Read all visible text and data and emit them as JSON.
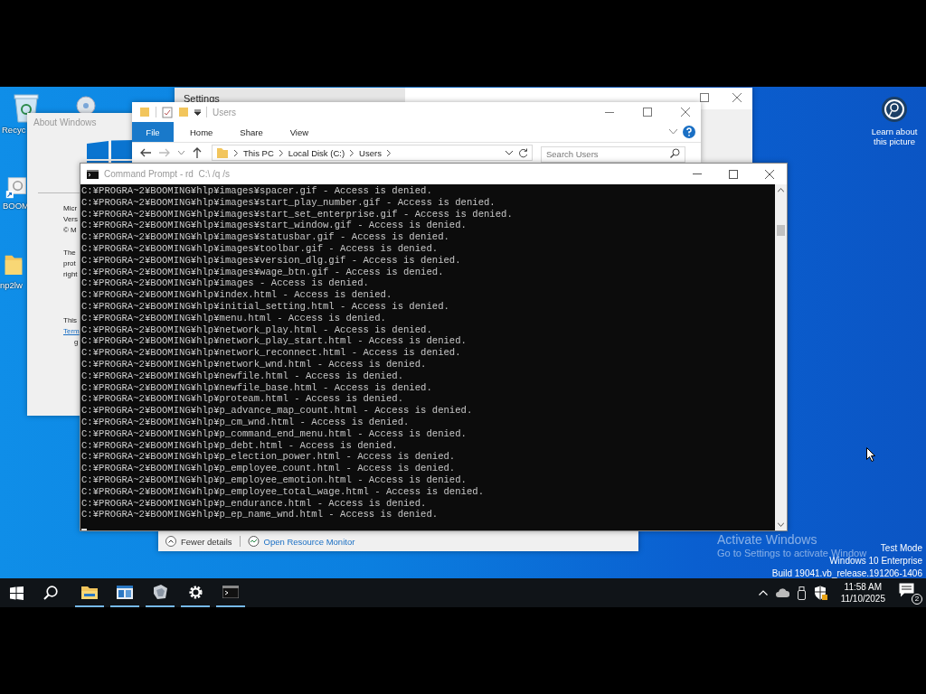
{
  "desktop_icons": [
    {
      "kind": "recycle",
      "label": "Recyc"
    },
    {
      "kind": "disc"
    },
    {
      "kind": "shortcut",
      "label": "BOOM"
    },
    {
      "kind": "folder",
      "label": "np2lw"
    }
  ],
  "learn_about": {
    "label": "Learn about this picture"
  },
  "settings_window": {
    "title": "Settings"
  },
  "about_window": {
    "title": "About Windows",
    "lines": [
      {
        "kind": "text",
        "text": "Micr"
      },
      {
        "kind": "text",
        "text": "Vers"
      },
      {
        "kind": "text",
        "text": "© M"
      },
      {
        "kind": "gap"
      },
      {
        "kind": "text",
        "text": "The"
      },
      {
        "kind": "text",
        "text": "prot"
      },
      {
        "kind": "text",
        "text": "right"
      },
      {
        "kind": "gap"
      },
      {
        "kind": "gap"
      },
      {
        "kind": "gap"
      },
      {
        "kind": "text",
        "text": "This"
      },
      {
        "kind": "link",
        "text": "Term"
      },
      {
        "kind": "indent",
        "text": "g"
      }
    ]
  },
  "explorer_window": {
    "title": "Users",
    "ribbon_tabs": [
      {
        "kind": "file",
        "label": "File"
      },
      {
        "kind": "tab",
        "label": "Home"
      },
      {
        "kind": "tab",
        "label": "Share"
      },
      {
        "kind": "tab",
        "label": "View"
      }
    ],
    "breadcrumbs": [
      "This PC",
      "Local Disk (C:)",
      "Users"
    ],
    "search": {
      "placeholder": "Search Users"
    }
  },
  "command_prompt": {
    "title": "Command Prompt - rd  C:\\ /q /s",
    "lines": [
      "C:¥PROGRA~2¥BOOMING¥hlp¥images¥spacer.gif - Access is denied.",
      "C:¥PROGRA~2¥BOOMING¥hlp¥images¥start_play_number.gif - Access is denied.",
      "C:¥PROGRA~2¥BOOMING¥hlp¥images¥start_set_enterprise.gif - Access is denied.",
      "C:¥PROGRA~2¥BOOMING¥hlp¥images¥start_window.gif - Access is denied.",
      "C:¥PROGRA~2¥BOOMING¥hlp¥images¥statusbar.gif - Access is denied.",
      "C:¥PROGRA~2¥BOOMING¥hlp¥images¥toolbar.gif - Access is denied.",
      "C:¥PROGRA~2¥BOOMING¥hlp¥images¥version_dlg.gif - Access is denied.",
      "C:¥PROGRA~2¥BOOMING¥hlp¥images¥wage_btn.gif - Access is denied.",
      "C:¥PROGRA~2¥BOOMING¥hlp¥images - Access is denied.",
      "C:¥PROGRA~2¥BOOMING¥hlp¥index.html - Access is denied.",
      "C:¥PROGRA~2¥BOOMING¥hlp¥initial_setting.html - Access is denied.",
      "C:¥PROGRA~2¥BOOMING¥hlp¥menu.html - Access is denied.",
      "C:¥PROGRA~2¥BOOMING¥hlp¥network_play.html - Access is denied.",
      "C:¥PROGRA~2¥BOOMING¥hlp¥network_play_start.html - Access is denied.",
      "C:¥PROGRA~2¥BOOMING¥hlp¥network_reconnect.html - Access is denied.",
      "C:¥PROGRA~2¥BOOMING¥hlp¥network_wnd.html - Access is denied.",
      "C:¥PROGRA~2¥BOOMING¥hlp¥newfile.html - Access is denied.",
      "C:¥PROGRA~2¥BOOMING¥hlp¥newfile_base.html - Access is denied.",
      "C:¥PROGRA~2¥BOOMING¥hlp¥proteam.html - Access is denied.",
      "C:¥PROGRA~2¥BOOMING¥hlp¥p_advance_map_count.html - Access is denied.",
      "C:¥PROGRA~2¥BOOMING¥hlp¥p_cm_wnd.html - Access is denied.",
      "C:¥PROGRA~2¥BOOMING¥hlp¥p_command_end_menu.html - Access is denied.",
      "C:¥PROGRA~2¥BOOMING¥hlp¥p_debt.html - Access is denied.",
      "C:¥PROGRA~2¥BOOMING¥hlp¥p_election_power.html - Access is denied.",
      "C:¥PROGRA~2¥BOOMING¥hlp¥p_employee_count.html - Access is denied.",
      "C:¥PROGRA~2¥BOOMING¥hlp¥p_employee_emotion.html - Access is denied.",
      "C:¥PROGRA~2¥BOOMING¥hlp¥p_employee_total_wage.html - Access is denied.",
      "C:¥PROGRA~2¥BOOMING¥hlp¥p_endurance.html - Access is denied.",
      "C:¥PROGRA~2¥BOOMING¥hlp¥p_ep_name_wnd.html - Access is denied."
    ]
  },
  "task_manager": {
    "details_button": "Fewer details",
    "monitor_link": "Open Resource Monitor"
  },
  "activation": {
    "title": "Activate Windows",
    "message": "Go to Settings to activate Window"
  },
  "build_info": [
    "Test Mode",
    "Windows 10 Enterprise",
    "Build 19041.vb_release.191206-1406"
  ],
  "taskbar": {
    "apps": [
      {
        "kind": "explorer",
        "running": true
      },
      {
        "kind": "window",
        "running": true
      },
      {
        "kind": "app",
        "running": true
      },
      {
        "kind": "settings",
        "running": true
      },
      {
        "kind": "terminal",
        "running": true
      }
    ],
    "clock": {
      "time": "11:58 AM",
      "date": "11/10/2025"
    },
    "notifications": {
      "count": "2"
    }
  }
}
